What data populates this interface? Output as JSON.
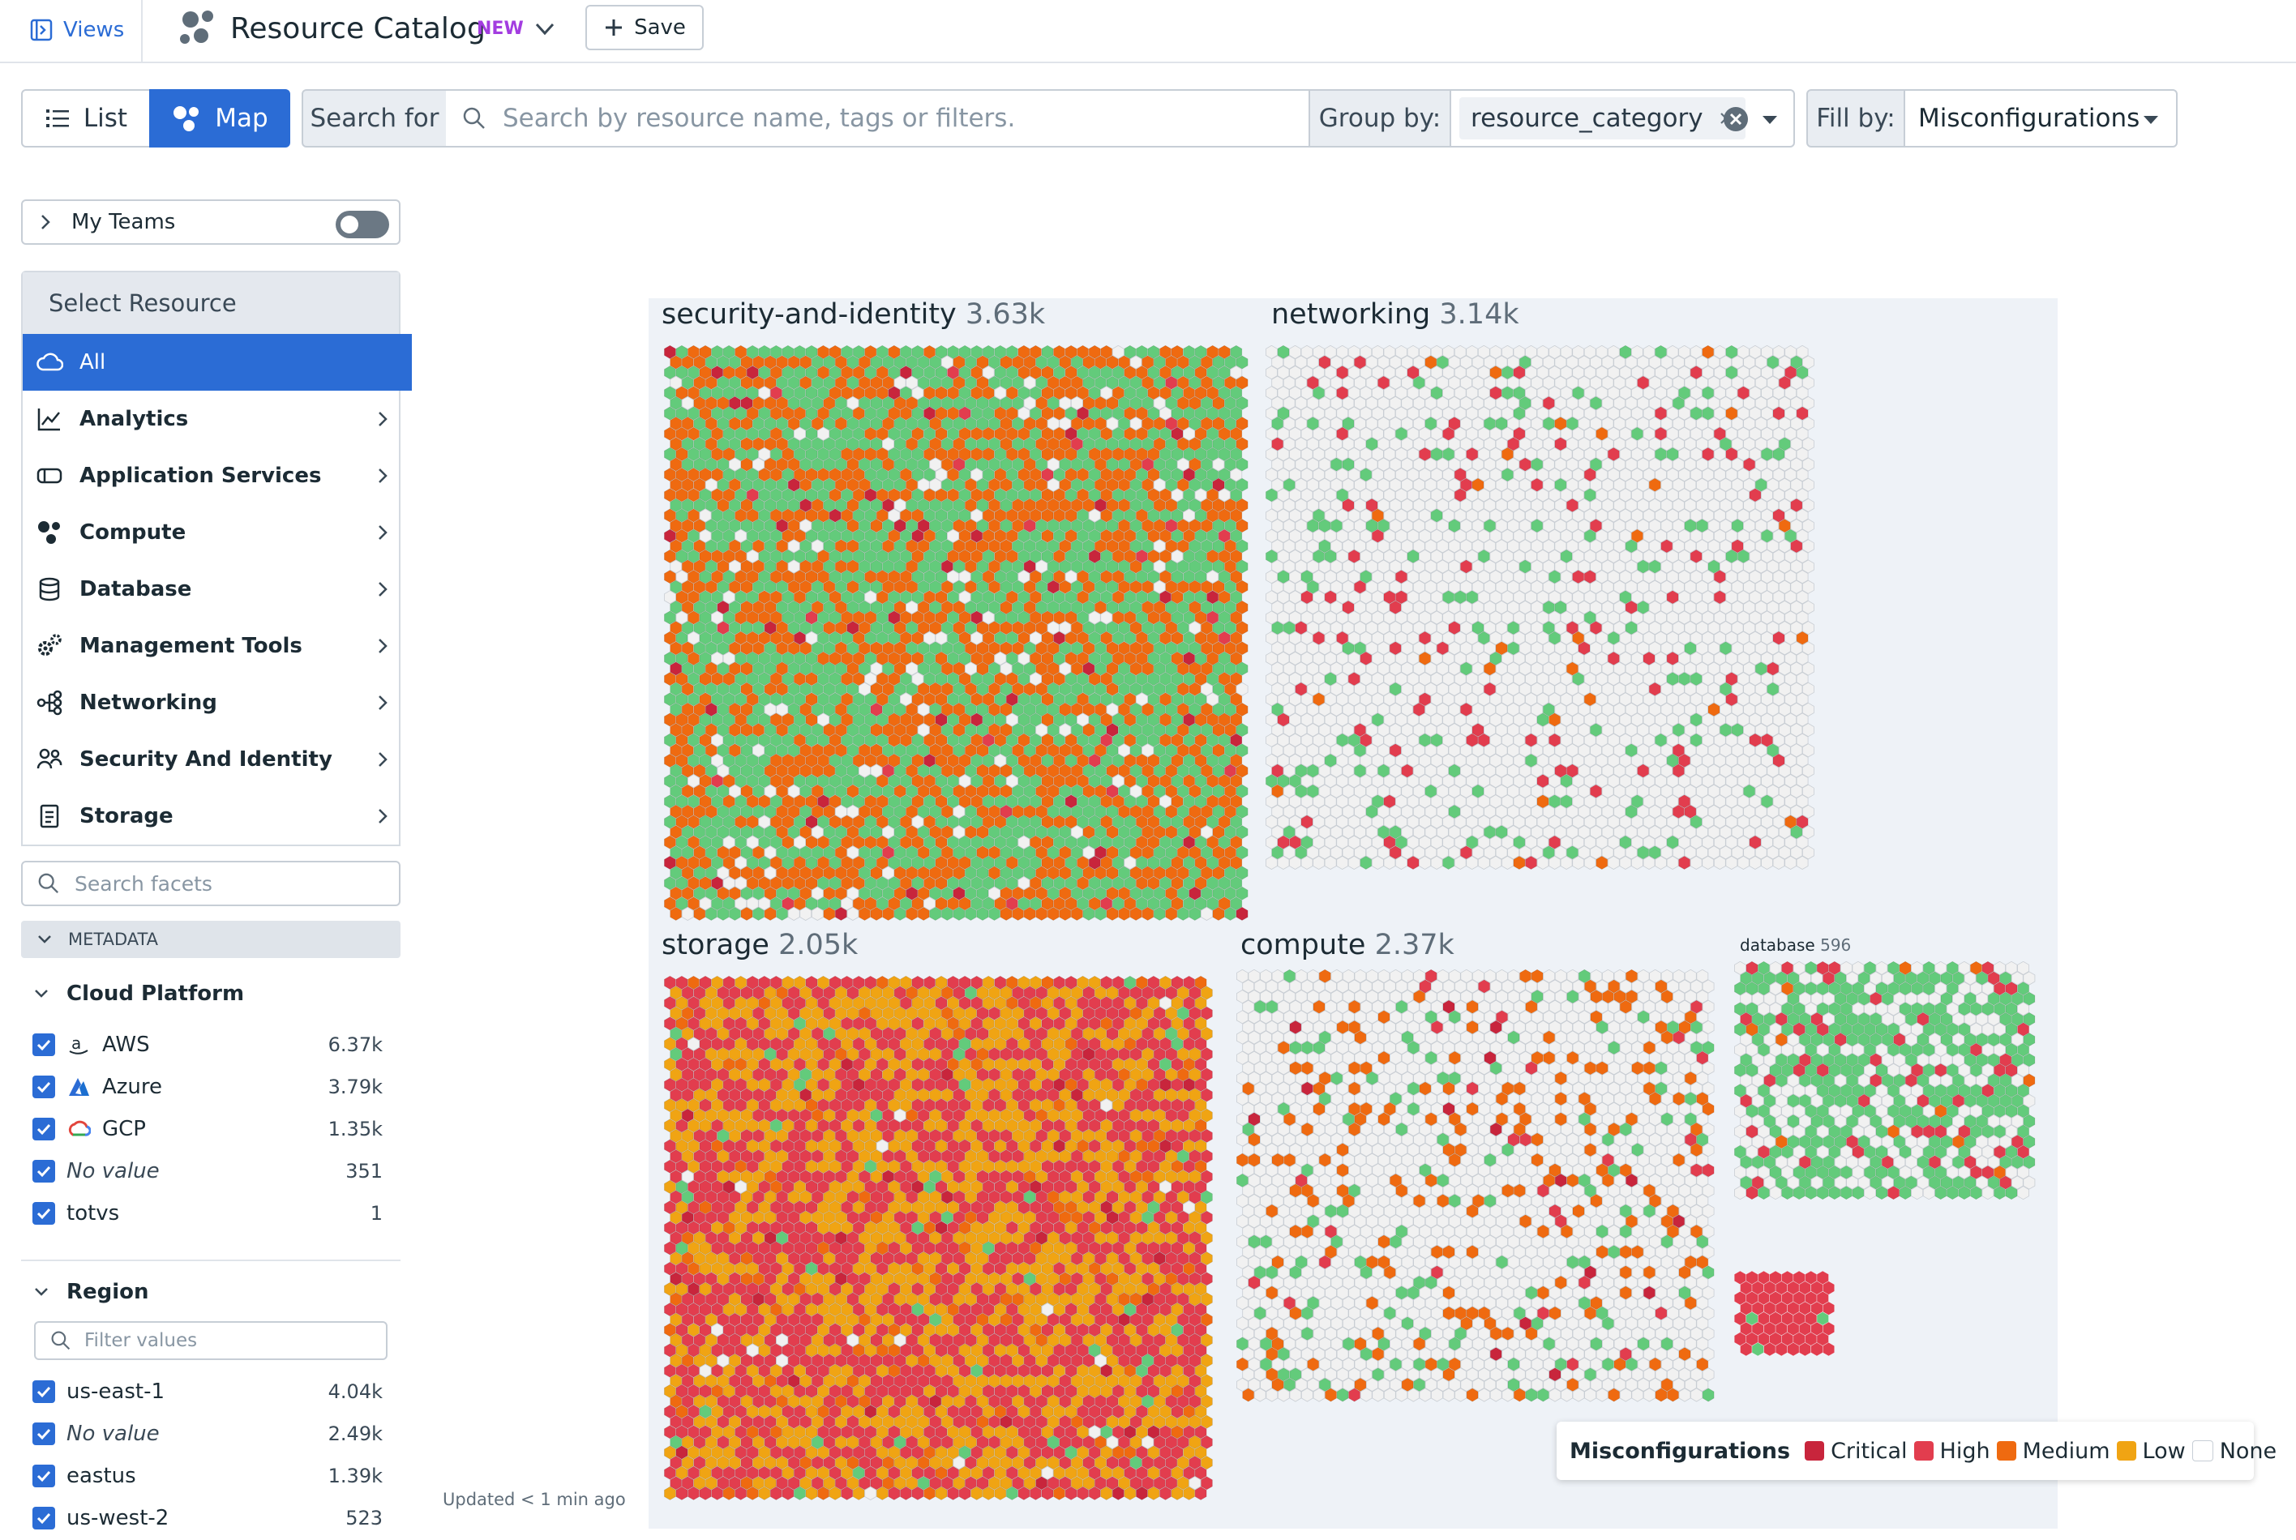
{
  "topbar": {
    "views_label": "Views",
    "title": "Resource Catalog",
    "new_badge": "NEW",
    "save_label": "Save"
  },
  "query": {
    "list_label": "List",
    "map_label": "Map",
    "search_for_label": "Search for",
    "search_placeholder": "Search by resource name, tags or filters.",
    "group_by_label": "Group by:",
    "group_by_value": "resource_category",
    "fill_by_label": "Fill by:",
    "fill_by_value": "Misconfigurations"
  },
  "sidebar": {
    "my_teams_label": "My Teams",
    "my_teams_enabled": false,
    "select_resource_label": "Select Resource",
    "resources": [
      {
        "label": "All",
        "icon": "cloud-icon",
        "active": true
      },
      {
        "label": "Analytics",
        "icon": "chart-line-icon"
      },
      {
        "label": "Application Services",
        "icon": "app-services-icon"
      },
      {
        "label": "Compute",
        "icon": "compute-icon"
      },
      {
        "label": "Database",
        "icon": "database-icon"
      },
      {
        "label": "Management Tools",
        "icon": "gears-icon"
      },
      {
        "label": "Networking",
        "icon": "network-icon"
      },
      {
        "label": "Security And Identity",
        "icon": "users-icon"
      },
      {
        "label": "Storage",
        "icon": "document-icon"
      }
    ],
    "facet_search_placeholder": "Search facets",
    "metadata_label": "METADATA",
    "cloud_platform": {
      "label": "Cloud Platform",
      "items": [
        {
          "label": "AWS",
          "count": "6.37k",
          "icon": "aws-icon"
        },
        {
          "label": "Azure",
          "count": "3.79k",
          "icon": "azure-icon"
        },
        {
          "label": "GCP",
          "count": "1.35k",
          "icon": "gcp-icon"
        },
        {
          "label": "No value",
          "count": "351"
        },
        {
          "label": "totvs",
          "count": "1"
        }
      ]
    },
    "region": {
      "label": "Region",
      "filter_placeholder": "Filter values",
      "items": [
        {
          "label": "us-east-1",
          "count": "4.04k"
        },
        {
          "label": "No value",
          "count": "2.49k"
        },
        {
          "label": "eastus",
          "count": "1.39k"
        },
        {
          "label": "us-west-2",
          "count": "523"
        }
      ]
    }
  },
  "updated_text": "Updated < 1 min ago",
  "map": {
    "categories": [
      {
        "name": "security-and-identity",
        "count": "3.63k",
        "mix": {
          "critical": 0.02,
          "high": 0.01,
          "medium": 0.44,
          "low": 0.0,
          "pass": 0.46,
          "none": 0.07
        }
      },
      {
        "name": "networking",
        "count": "3.14k",
        "mix": {
          "critical": 0.0,
          "high": 0.05,
          "medium": 0.01,
          "low": 0.0,
          "pass": 0.08,
          "none": 0.86
        }
      },
      {
        "name": "storage",
        "count": "2.05k",
        "mix": {
          "critical": 0.02,
          "high": 0.47,
          "medium": 0.06,
          "low": 0.41,
          "pass": 0.03,
          "none": 0.01
        }
      },
      {
        "name": "compute",
        "count": "2.37k",
        "mix": {
          "critical": 0.01,
          "high": 0.02,
          "medium": 0.12,
          "low": 0.0,
          "pass": 0.07,
          "none": 0.78
        }
      },
      {
        "name": "database",
        "count": "596",
        "mix": {
          "critical": 0.0,
          "high": 0.12,
          "medium": 0.01,
          "low": 0.0,
          "pass": 0.52,
          "none": 0.35
        }
      }
    ]
  },
  "legend": {
    "title": "Misconfigurations",
    "items": [
      {
        "label": "Critical",
        "color": "#c8253c"
      },
      {
        "label": "High",
        "color": "#e23d4e"
      },
      {
        "label": "Medium",
        "color": "#ef6a10"
      },
      {
        "label": "Low",
        "color": "#f0a413"
      },
      {
        "label": "None",
        "color": "#ffffff"
      }
    ]
  },
  "colors": {
    "accent": "#2b6cd5",
    "pass": "#63cb7b",
    "empty": "#f1f1f1",
    "new_badge": "#a33de0"
  }
}
